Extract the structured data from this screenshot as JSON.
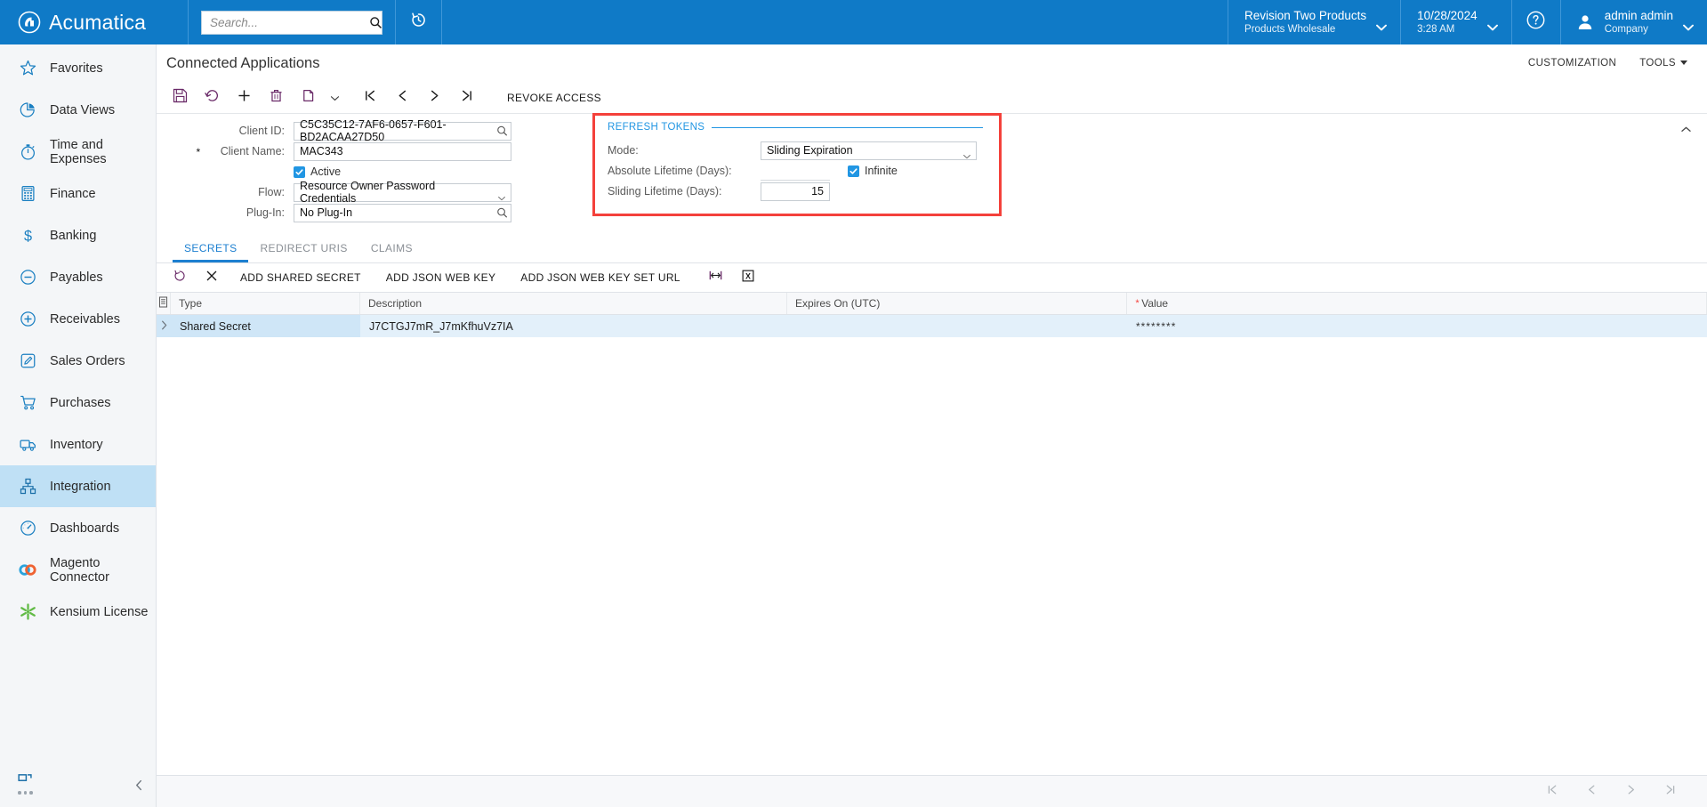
{
  "topbar": {
    "brand": "Acumatica",
    "brand_logo_icon": "acumatica-logo-icon",
    "search": {
      "placeholder": "Search...",
      "value": "",
      "icon": "search-icon"
    },
    "recent_icon": "recently-viewed-icon",
    "company": {
      "line1": "Revision Two Products",
      "line2": "Products Wholesale",
      "chevron_icon": "chevron-down-icon"
    },
    "datetime": {
      "line1": "10/28/2024",
      "line2": "3:28 AM",
      "chevron_icon": "chevron-down-icon"
    },
    "help_icon": "help-circle-icon",
    "user": {
      "name": "admin admin",
      "role": "Company",
      "avatar_icon": "user-avatar-icon",
      "chevron_icon": "chevron-down-icon"
    }
  },
  "sidebar": {
    "items": [
      {
        "label": "Favorites",
        "icon": "star-icon",
        "active": false
      },
      {
        "label": "Data Views",
        "icon": "pie-chart-icon",
        "active": false
      },
      {
        "label": "Time and Expenses",
        "icon": "stopwatch-icon",
        "active": false
      },
      {
        "label": "Finance",
        "icon": "calculator-icon",
        "active": false
      },
      {
        "label": "Banking",
        "icon": "dollar-icon",
        "active": false
      },
      {
        "label": "Payables",
        "icon": "minus-circle-icon",
        "active": false
      },
      {
        "label": "Receivables",
        "icon": "plus-circle-icon",
        "active": false
      },
      {
        "label": "Sales Orders",
        "icon": "pencil-square-icon",
        "active": false
      },
      {
        "label": "Purchases",
        "icon": "shopping-cart-icon",
        "active": false
      },
      {
        "label": "Inventory",
        "icon": "truck-icon",
        "active": false
      },
      {
        "label": "Integration",
        "icon": "sitemap-icon",
        "active": true
      },
      {
        "label": "Dashboards",
        "icon": "gauge-icon",
        "active": false
      },
      {
        "label": "Magento Connector",
        "icon": "magento-link-icon",
        "active": false
      },
      {
        "label": "Kensium License",
        "icon": "kensium-burst-icon",
        "active": false
      }
    ],
    "more_icon": "window-icon",
    "overflow_icon": "ellipsis-icon",
    "collapse_icon": "chevron-left-icon"
  },
  "page": {
    "title": "Connected Applications",
    "customization_label": "CUSTOMIZATION",
    "tools_label": "TOOLS"
  },
  "toolbar": {
    "buttons": [
      {
        "name": "save-button",
        "icon": "save-icon"
      },
      {
        "name": "undo-button",
        "icon": "undo-icon"
      },
      {
        "name": "add-new-record-button",
        "icon": "plus-icon"
      },
      {
        "name": "delete-record-button",
        "icon": "trash-icon"
      },
      {
        "name": "copy-paste-button",
        "icon": "clipboard-icon"
      },
      {
        "name": "copy-paste-dropdown",
        "icon": "chevron-down-icon"
      },
      {
        "name": "first-record-button",
        "icon": "first-page-icon"
      },
      {
        "name": "previous-record-button",
        "icon": "previous-icon"
      },
      {
        "name": "next-record-button",
        "icon": "next-icon"
      },
      {
        "name": "last-record-button",
        "icon": "last-page-icon"
      }
    ],
    "revoke_access_label": "REVOKE ACCESS"
  },
  "form": {
    "collapse_icon": "chevron-up-icon",
    "client_id": {
      "label": "Client ID:",
      "value": "C5C35C12-7AF6-0657-F601-BD2ACAA27D50",
      "icon": "magnifier-selector-icon"
    },
    "client_name": {
      "label": "Client Name:",
      "value": "MAC343",
      "required": true
    },
    "active": {
      "label": "Active",
      "checked": true
    },
    "flow": {
      "label": "Flow:",
      "value": "Resource Owner Password Credentials",
      "icon": "chevron-down-icon"
    },
    "plug_in": {
      "label": "Plug-In:",
      "value": "No Plug-In",
      "icon": "magnifier-selector-icon"
    }
  },
  "refresh_tokens": {
    "title": "REFRESH TOKENS",
    "highlight_color": "#f4413b",
    "accent_color": "#2196e3",
    "mode": {
      "label": "Mode:",
      "value": "Sliding Expiration",
      "icon": "chevron-down-icon"
    },
    "absolute_lifetime": {
      "label": "Absolute Lifetime (Days):",
      "value": ""
    },
    "infinite": {
      "label": "Infinite",
      "checked": true
    },
    "sliding_lifetime": {
      "label": "Sliding Lifetime (Days):",
      "value": "15"
    }
  },
  "tabs": [
    {
      "label": "SECRETS",
      "active": true
    },
    {
      "label": "REDIRECT URIS",
      "active": false
    },
    {
      "label": "CLAIMS",
      "active": false
    }
  ],
  "grid_toolbar": {
    "refresh_icon": "refresh-icon",
    "delete_icon": "close-x-icon",
    "add_shared_secret_label": "ADD SHARED SECRET",
    "add_json_web_key_label": "ADD JSON WEB KEY",
    "add_json_web_key_set_url_label": "ADD JSON WEB KEY SET URL",
    "fit_columns_icon": "fit-to-width-icon",
    "export_excel_icon": "export-excel-icon"
  },
  "grid": {
    "columns": [
      {
        "key": "sel",
        "label": "",
        "icon": "column-settings-icon"
      },
      {
        "key": "type",
        "label": "Type"
      },
      {
        "key": "description",
        "label": "Description"
      },
      {
        "key": "expires",
        "label": "Expires On (UTC)"
      },
      {
        "key": "value",
        "label": "Value",
        "required": true
      }
    ],
    "rows": [
      {
        "expand_icon": "chevron-right-icon",
        "type": "Shared Secret",
        "description": "J7CTGJ7mR_J7mKfhuVz7IA",
        "expires": "",
        "value": "********"
      }
    ]
  },
  "bottombar": {
    "buttons": [
      {
        "name": "first-page-button",
        "icon": "first-page-icon"
      },
      {
        "name": "previous-page-button",
        "icon": "previous-icon"
      },
      {
        "name": "next-page-button",
        "icon": "next-icon"
      },
      {
        "name": "last-page-button",
        "icon": "last-page-icon"
      }
    ]
  }
}
